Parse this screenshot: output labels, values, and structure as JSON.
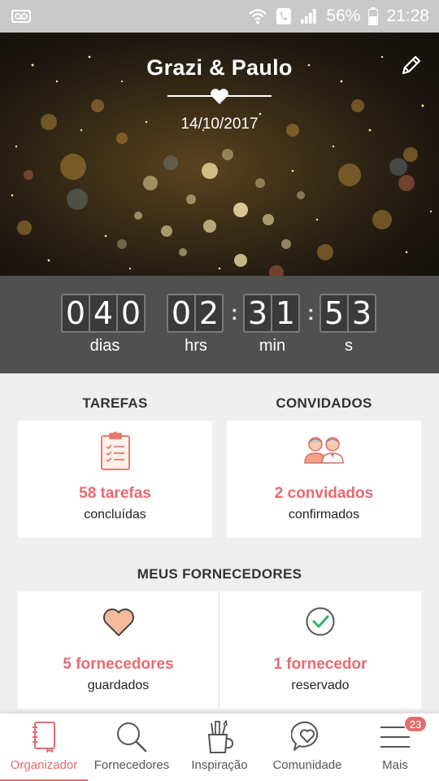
{
  "status_bar": {
    "battery_percent": "56%",
    "time": "21:28",
    "icons": [
      "voicemail-icon",
      "wifi-icon",
      "call-icon",
      "signal-icon",
      "battery-icon"
    ]
  },
  "header": {
    "couple_names": "Grazi & Paulo",
    "wedding_date": "14/10/2017",
    "edit_icon": "pencil-icon"
  },
  "countdown": {
    "days": [
      "0",
      "4",
      "0"
    ],
    "hours": [
      "0",
      "2"
    ],
    "minutes": [
      "3",
      "1"
    ],
    "seconds": [
      "5",
      "3"
    ],
    "days_label": "dias",
    "hours_label": "hrs",
    "minutes_label": "min",
    "seconds_label": "s"
  },
  "tasks": {
    "title": "TAREFAS",
    "count": "58 tarefas",
    "status": "concluídas",
    "icon": "clipboard-checklist-icon"
  },
  "guests": {
    "title": "CONVIDADOS",
    "count": "2 convidados",
    "status": "confirmados",
    "icon": "couple-icon"
  },
  "vendors": {
    "title": "MEUS FORNECEDORES",
    "saved_count": "5 fornecedores",
    "saved_status": "guardados",
    "saved_icon": "heart-icon",
    "booked_count": "1 fornecedor",
    "booked_status": "reservado",
    "booked_icon": "check-circle-icon"
  },
  "bottom_nav": {
    "items": [
      {
        "label": "Organizador",
        "icon": "notebook-icon",
        "active": true
      },
      {
        "label": "Fornecedores",
        "icon": "search-icon",
        "active": false
      },
      {
        "label": "Inspiração",
        "icon": "pencil-cup-icon",
        "active": false
      },
      {
        "label": "Comunidade",
        "icon": "chat-heart-icon",
        "active": false
      },
      {
        "label": "Mais",
        "icon": "menu-icon",
        "active": false
      }
    ],
    "more_badge": "23"
  },
  "colors": {
    "accent": "#e56b6f",
    "countdown_bg": "#505050",
    "status_bar": "#c9c9c9"
  }
}
